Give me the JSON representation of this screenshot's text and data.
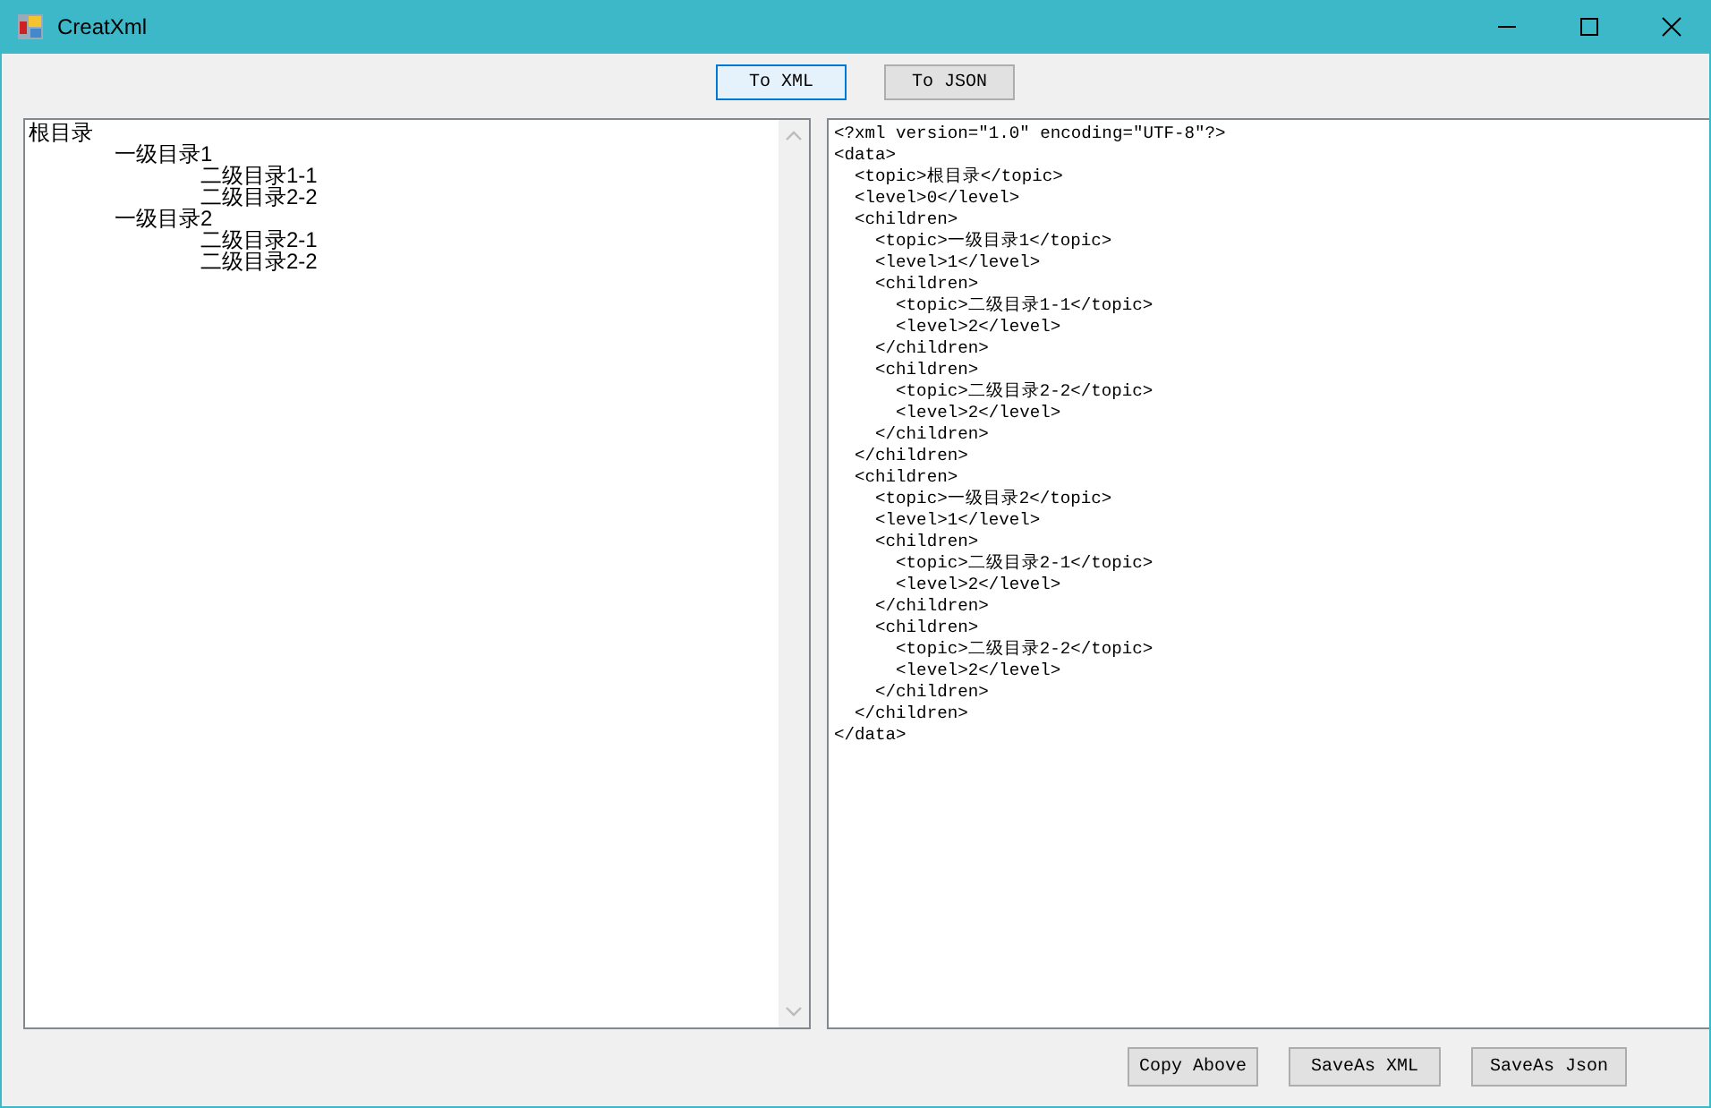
{
  "window": {
    "title": "CreatXml"
  },
  "top_buttons": [
    {
      "label": "To XML",
      "focused": true
    },
    {
      "label": "To JSON",
      "focused": false
    }
  ],
  "tree": {
    "items": [
      {
        "text": "根目录",
        "children": [
          {
            "text": "一级目录1",
            "children": [
              {
                "text": "二级目录1-1"
              },
              {
                "text": "二级目录2-2"
              }
            ]
          },
          {
            "text": "一级目录2",
            "children": [
              {
                "text": "二级目录2-1"
              },
              {
                "text": "二级目录2-2"
              }
            ]
          }
        ]
      }
    ]
  },
  "output": {
    "lines": [
      "<?xml version=\"1.0\" encoding=\"UTF-8\"?>",
      "<data>",
      "  <topic>根目录</topic>",
      "  <level>0</level>",
      "  <children>",
      "    <topic>一级目录1</topic>",
      "    <level>1</level>",
      "    <children>",
      "      <topic>二级目录1-1</topic>",
      "      <level>2</level>",
      "    </children>",
      "    <children>",
      "      <topic>二级目录2-2</topic>",
      "      <level>2</level>",
      "    </children>",
      "  </children>",
      "  <children>",
      "    <topic>一级目录2</topic>",
      "    <level>1</level>",
      "    <children>",
      "      <topic>二级目录2-1</topic>",
      "      <level>2</level>",
      "    </children>",
      "    <children>",
      "      <topic>二级目录2-2</topic>",
      "      <level>2</level>",
      "    </children>",
      "  </children>",
      "</data>"
    ]
  },
  "bottom_buttons": [
    {
      "label": "Copy Above"
    },
    {
      "label": "SaveAs XML"
    },
    {
      "label": "SaveAs Json"
    }
  ]
}
